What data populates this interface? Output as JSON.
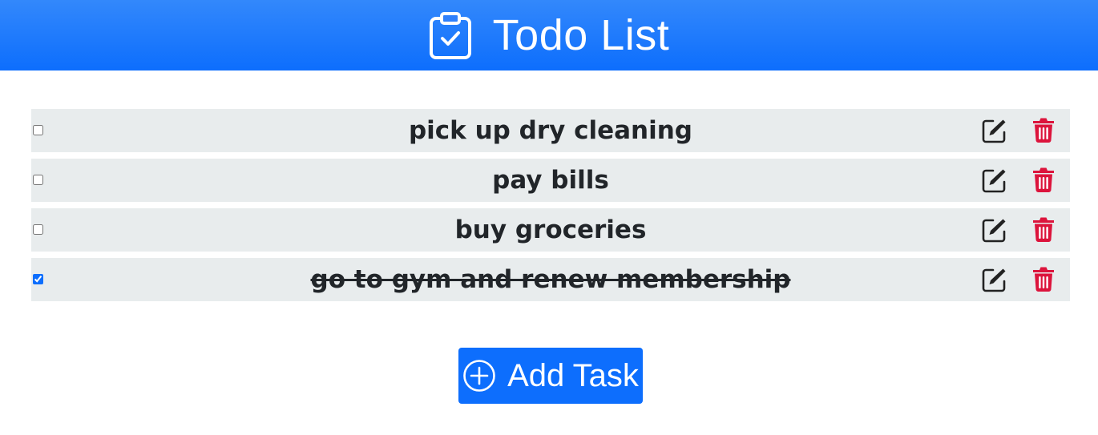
{
  "header": {
    "title": "Todo List",
    "icon": "clipboard-check-icon",
    "color": "#0d6efd"
  },
  "tasks": [
    {
      "text": "pick up dry cleaning",
      "done": false
    },
    {
      "text": "pay bills",
      "done": false
    },
    {
      "text": "buy groceries",
      "done": false
    },
    {
      "text": "go to gym and renew membership",
      "done": true
    }
  ],
  "actions": {
    "edit_icon": "pencil-square-icon",
    "delete_icon": "trash-icon",
    "delete_color": "#dc143c"
  },
  "add_button": {
    "label": "Add Task",
    "icon": "plus-circle-icon"
  }
}
